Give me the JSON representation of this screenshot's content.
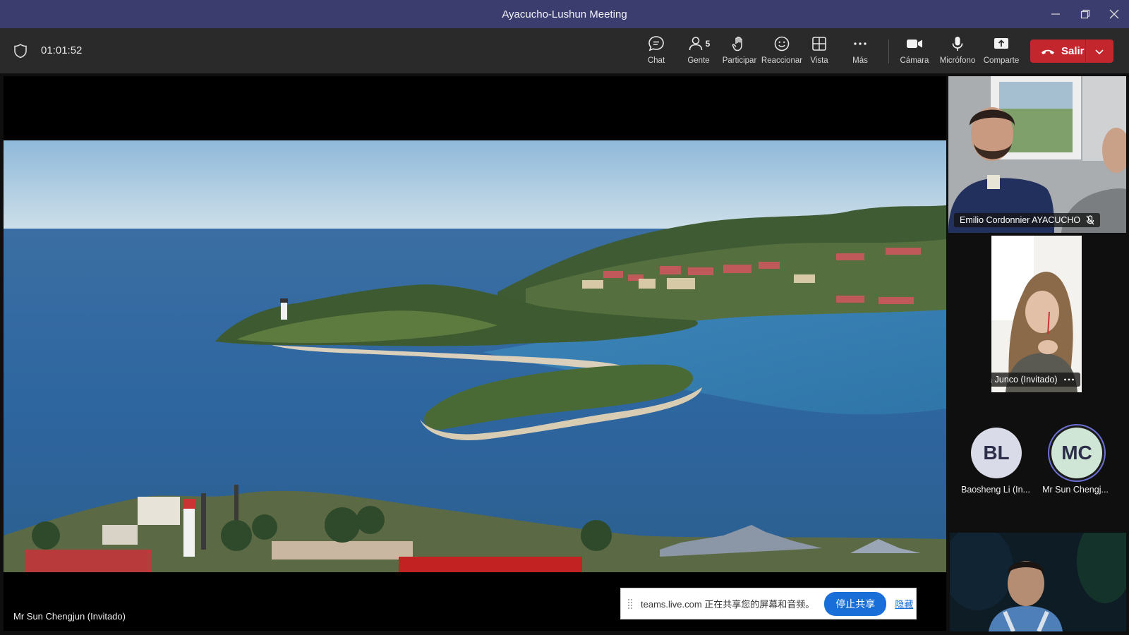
{
  "window": {
    "title": "Ayacucho-Lushun Meeting",
    "controls": [
      "minimize",
      "restore",
      "close"
    ]
  },
  "toolbar": {
    "timer": "01:01:52",
    "buttons": [
      {
        "label": "Chat",
        "icon": "chat-icon"
      },
      {
        "label": "Gente",
        "icon": "people-icon",
        "badge": "5"
      },
      {
        "label": "Participar",
        "icon": "raise-hand-icon"
      },
      {
        "label": "Reaccionar",
        "icon": "smiley-icon"
      },
      {
        "label": "Vista",
        "icon": "grid-view-icon"
      },
      {
        "label": "Más",
        "icon": "more-icon"
      },
      {
        "label": "Cámara",
        "icon": "camera-icon"
      },
      {
        "label": "Micrófono",
        "icon": "microphone-icon"
      },
      {
        "label": "Comparte",
        "icon": "share-tray-icon"
      }
    ],
    "leave_label": "Salir"
  },
  "stage": {
    "presenter_name": "Mr Sun Chengjun (Invitado)"
  },
  "share_banner": {
    "text": "teams.live.com 正在共享您的屏幕和音频。",
    "stop_label": "停止共享",
    "hide_label": "隐藏"
  },
  "participants": {
    "video_tiles": [
      {
        "name": "Emilio Cordonnier AYACUCHO",
        "muted": true
      },
      {
        "name": "Mariana Junco (Invitado)"
      }
    ],
    "avatars": [
      {
        "initials": "BL",
        "name": "Baosheng Li (In...",
        "color": "#d9dbe8"
      },
      {
        "initials": "MC",
        "name": "Mr Sun Chengj...",
        "color": "#cfe5d5",
        "speaking_ring": "#6b6fd1"
      }
    ]
  },
  "colors": {
    "titlebar": "#3b3d6e",
    "toolbar": "#2a2a2a",
    "leave": "#c4262e",
    "stop_share": "#1a6ed8"
  }
}
